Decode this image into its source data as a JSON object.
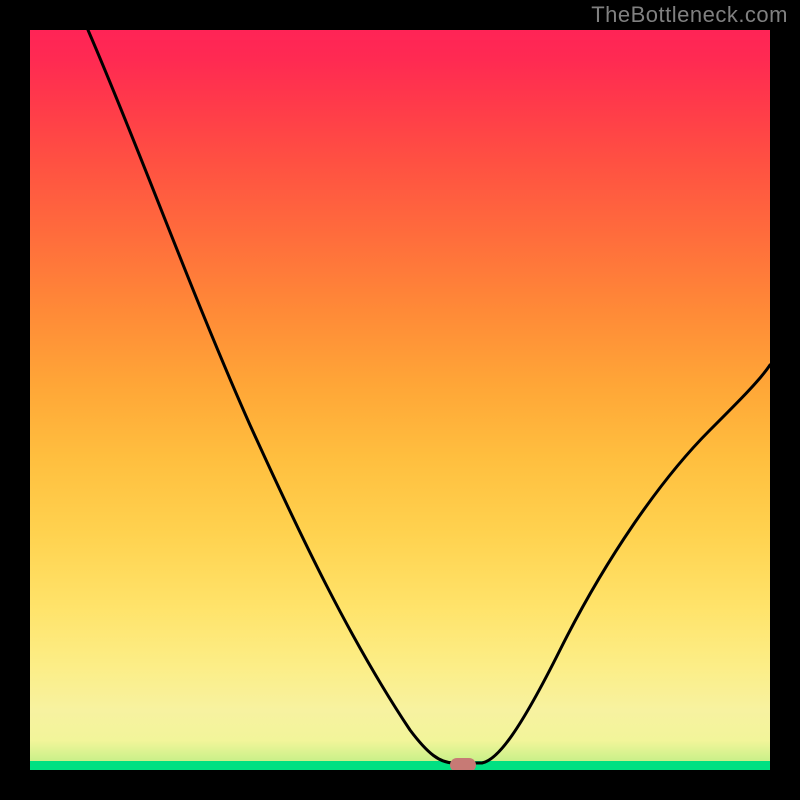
{
  "watermark": "TheBottleneck.com",
  "chart_data": {
    "type": "line",
    "title": "",
    "xlabel": "",
    "ylabel": "",
    "x": [
      0.0,
      0.05,
      0.1,
      0.15,
      0.2,
      0.25,
      0.3,
      0.35,
      0.4,
      0.45,
      0.5,
      0.53,
      0.56,
      0.58,
      0.6,
      0.65,
      0.7,
      0.75,
      0.8,
      0.85,
      0.9,
      0.95,
      1.0
    ],
    "values": [
      1.0,
      0.92,
      0.84,
      0.76,
      0.69,
      0.62,
      0.55,
      0.47,
      0.39,
      0.3,
      0.2,
      0.1,
      0.03,
      0.01,
      0.01,
      0.06,
      0.15,
      0.25,
      0.34,
      0.42,
      0.48,
      0.53,
      0.56
    ],
    "xlim": [
      0,
      1
    ],
    "ylim": [
      0,
      1
    ],
    "marker": {
      "x": 0.585,
      "y": 0.005
    },
    "colors": {
      "gradient_top": "#ff2456",
      "gradient_bottom": "#00e082",
      "curve": "#000000",
      "marker": "#c77a75",
      "frame": "#000000"
    }
  }
}
